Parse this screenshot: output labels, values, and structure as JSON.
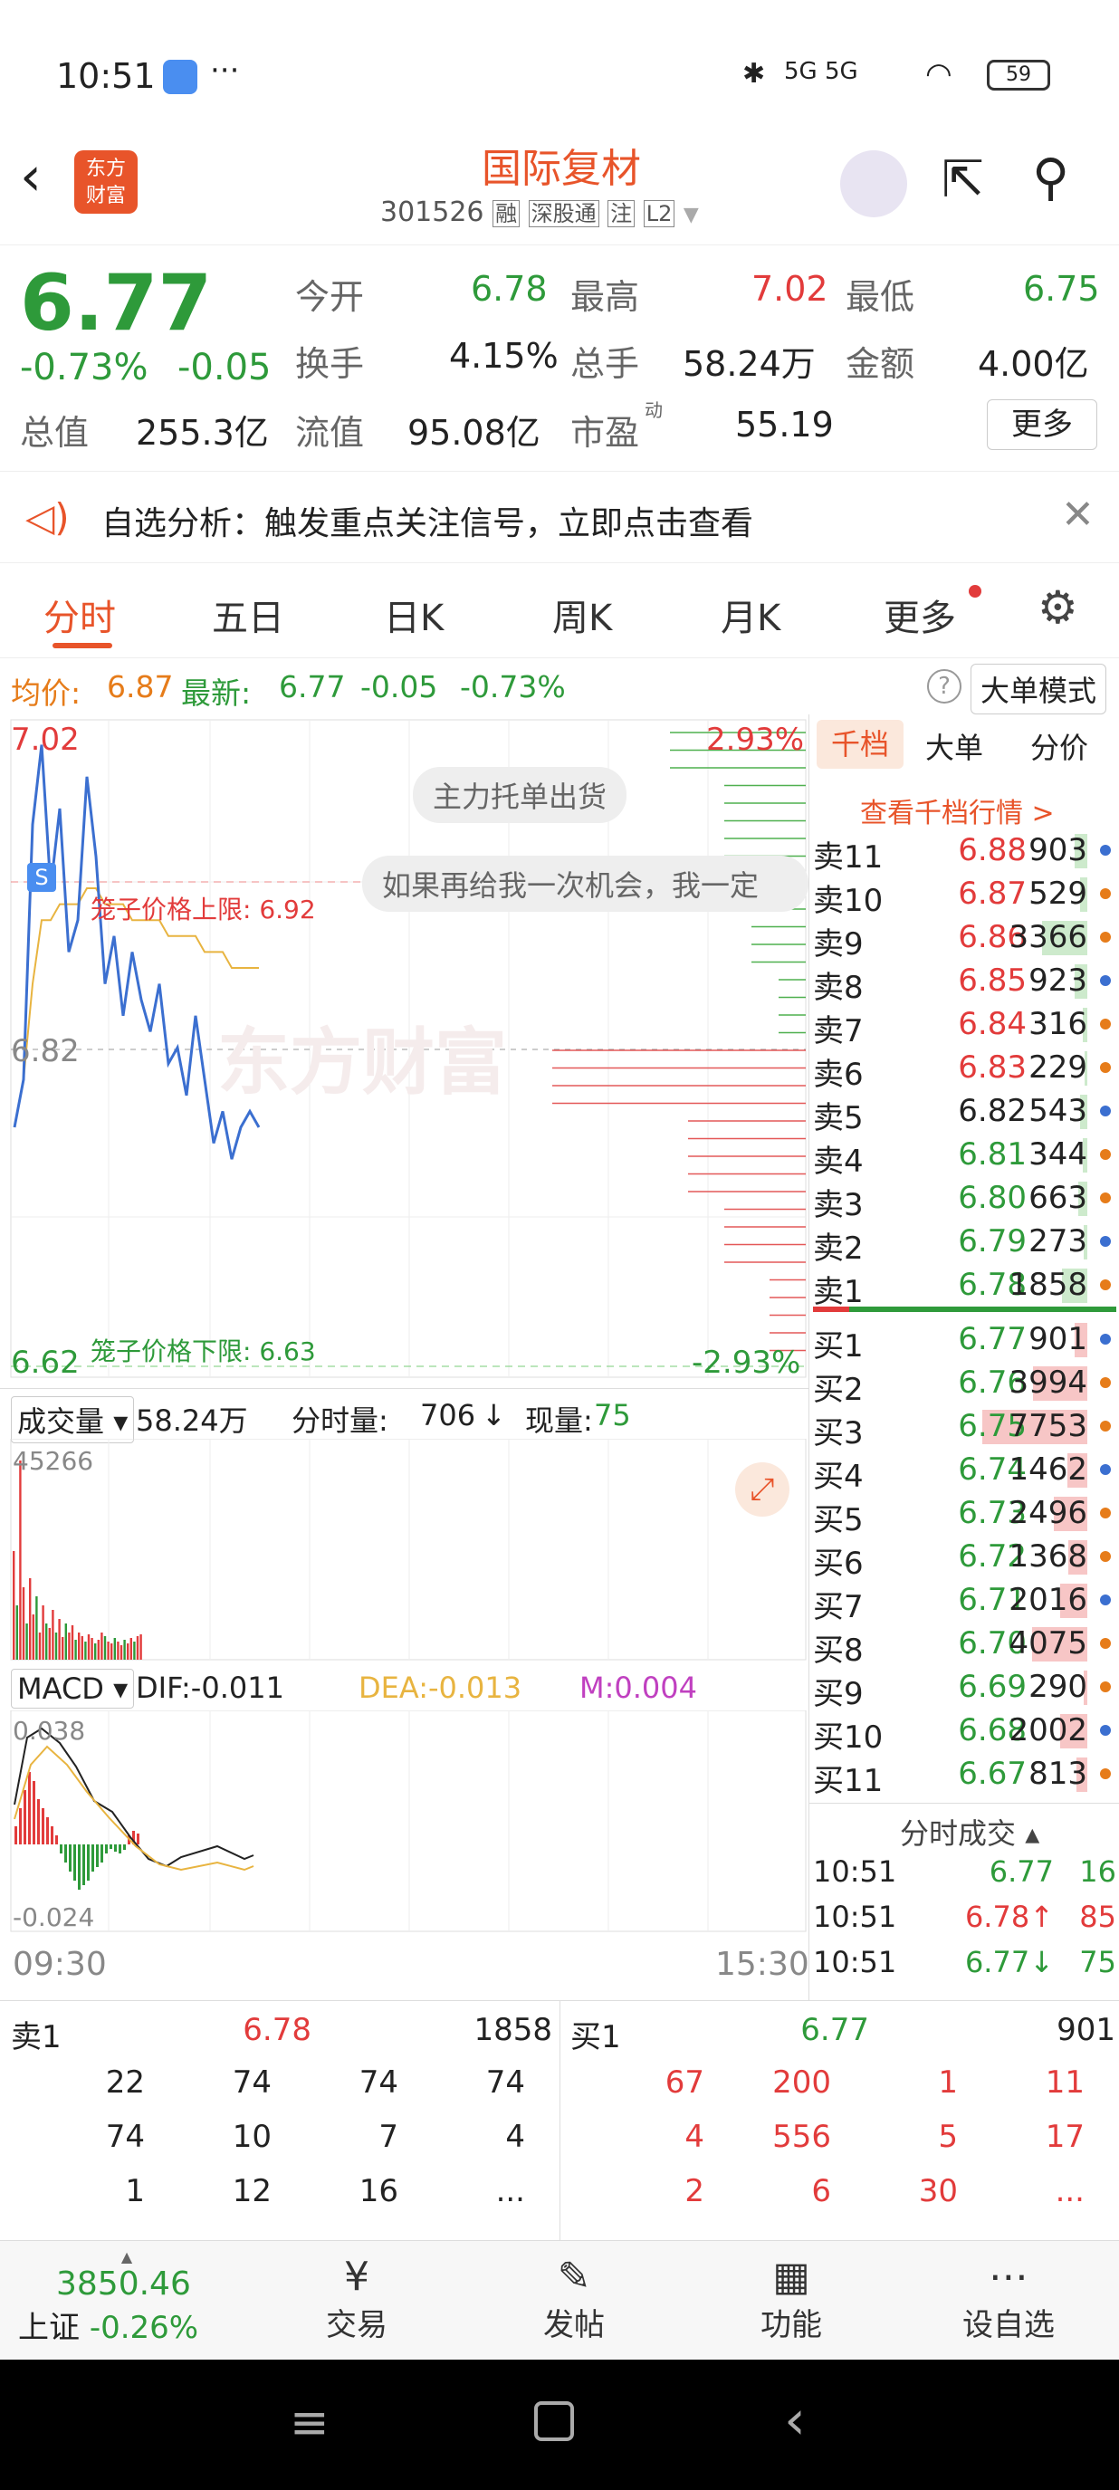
{
  "status": {
    "time": "10:51",
    "signal": "5G 5G",
    "battery": "59"
  },
  "header": {
    "logo_line1": "东方",
    "logo_line2": "财富",
    "title": "国际复材",
    "code": "301526",
    "tags": [
      "融",
      "深股通",
      "注",
      "L2"
    ]
  },
  "quote": {
    "price": "6.77",
    "pct": "-0.73%",
    "chg": "-0.05",
    "today_open_label": "今开",
    "today_open": "6.78",
    "high_label": "最高",
    "high": "7.02",
    "low_label": "最低",
    "low": "6.75",
    "turnover_label": "换手",
    "turnover": "4.15%",
    "total_hands_label": "总手",
    "total_hands": "58.24万",
    "amount_label": "金额",
    "amount": "4.00亿",
    "mktcap_label": "总值",
    "mktcap": "255.3亿",
    "float_label": "流值",
    "float": "95.08亿",
    "pe_label": "市盈",
    "pe_sup": "动",
    "pe": "55.19",
    "more": "更多"
  },
  "banner": {
    "text": "自选分析：触发重点关注信号，立即点击查看"
  },
  "tabs": [
    "分时",
    "五日",
    "日K",
    "周K",
    "月K",
    "更多"
  ],
  "infobar": {
    "avg_label": "均价:",
    "avg": "6.87",
    "last_label": "最新:",
    "last": "6.77",
    "chg": "-0.05",
    "pct": "-0.73%",
    "mode": "大单模式"
  },
  "chart": {
    "top_price": "7.02",
    "mid_price": "6.82",
    "bottom_price": "6.62",
    "top_pct": "2.93%",
    "bottom_pct": "-2.93%",
    "upper_limit": "笼子价格上限: 6.92",
    "lower_limit": "笼子价格下限: 6.63",
    "bubble1": "主力托单出货",
    "bubble2": "如果再给我一次机会，我一定",
    "watermark": "东方财富",
    "vol_label": "成交量",
    "vol_total": "58.24万",
    "vol_min_label": "分时量:",
    "vol_min": "706",
    "vol_now_label": "现量:",
    "vol_now": "75",
    "vol_max": "45266",
    "macd_label": "MACD",
    "dif": "DIF:-0.011",
    "dea": "DEA:-0.013",
    "m": "M:0.004",
    "macd_top": "0.038",
    "macd_bottom": "-0.024",
    "time_start": "09:30",
    "time_end": "15:30"
  },
  "chart_data": {
    "type": "line",
    "series": [
      {
        "name": "最新",
        "values": [
          6.77,
          6.8,
          6.96,
          7.01,
          6.92,
          6.97,
          6.88,
          6.9,
          6.99,
          6.94,
          6.86,
          6.89,
          6.84,
          6.88,
          6.85,
          6.83,
          6.86,
          6.81,
          6.82,
          6.79,
          6.84,
          6.8,
          6.76,
          6.78,
          6.75,
          6.77,
          6.78,
          6.77
        ]
      },
      {
        "name": "均价",
        "values": [
          6.77,
          6.8,
          6.86,
          6.9,
          6.9,
          6.91,
          6.91,
          6.91,
          6.92,
          6.92,
          6.91,
          6.91,
          6.91,
          6.9,
          6.9,
          6.9,
          6.9,
          6.89,
          6.89,
          6.89,
          6.89,
          6.88,
          6.88,
          6.88,
          6.87,
          6.87,
          6.87,
          6.87
        ]
      }
    ],
    "ylim": [
      6.62,
      7.02
    ]
  },
  "rightpanel": {
    "tabs": [
      "千档",
      "大单",
      "分价"
    ],
    "link": "查看千档行情 >",
    "asks": [
      [
        "卖11",
        "6.88",
        "903"
      ],
      [
        "卖10",
        "6.87",
        "529"
      ],
      [
        "卖9",
        "6.86",
        "3366"
      ],
      [
        "卖8",
        "6.85",
        "923"
      ],
      [
        "卖7",
        "6.84",
        "316"
      ],
      [
        "卖6",
        "6.83",
        "229"
      ],
      [
        "卖5",
        "6.82",
        "543"
      ],
      [
        "卖4",
        "6.81",
        "344"
      ],
      [
        "卖3",
        "6.80",
        "663"
      ],
      [
        "卖2",
        "6.79",
        "273"
      ],
      [
        "卖1",
        "6.78",
        "1858"
      ]
    ],
    "bids": [
      [
        "买1",
        "6.77",
        "901"
      ],
      [
        "买2",
        "6.76",
        "3994"
      ],
      [
        "买3",
        "6.75",
        "7753"
      ],
      [
        "买4",
        "6.74",
        "1462"
      ],
      [
        "买5",
        "6.73",
        "2496"
      ],
      [
        "买6",
        "6.72",
        "1368"
      ],
      [
        "买7",
        "6.71",
        "2016"
      ],
      [
        "买8",
        "6.70",
        "4075"
      ],
      [
        "买9",
        "6.69",
        "290"
      ],
      [
        "买10",
        "6.68",
        "2002"
      ],
      [
        "买11",
        "6.67",
        "813"
      ]
    ],
    "trades_title": "分时成交",
    "trades": [
      [
        "10:51",
        "6.77",
        "16"
      ],
      [
        "10:51",
        "6.78↑",
        "85"
      ],
      [
        "10:51",
        "6.77↓",
        "75"
      ]
    ]
  },
  "bottomq": {
    "sell_label": "卖1",
    "sell_price": "6.78",
    "sell_vol": "1858",
    "buy_label": "买1",
    "buy_price": "6.77",
    "buy_vol": "901",
    "sell_rows": [
      [
        "22",
        "74",
        "74",
        "74"
      ],
      [
        "74",
        "10",
        "7",
        "4"
      ],
      [
        "1",
        "12",
        "16",
        "..."
      ]
    ],
    "buy_rows": [
      [
        "67",
        "200",
        "1",
        "11"
      ],
      [
        "4",
        "556",
        "5",
        "17"
      ],
      [
        "2",
        "6",
        "30",
        "..."
      ]
    ]
  },
  "tabbar": {
    "index_value": "3850.46",
    "index_name": "上证",
    "index_pct": "-0.26%",
    "items": [
      "交易",
      "发帖",
      "功能",
      "设自选"
    ]
  }
}
